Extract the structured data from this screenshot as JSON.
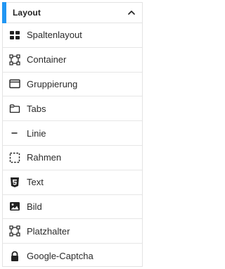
{
  "colors": {
    "accent": "#2196f3",
    "icon": "#222222",
    "text": "#2b2b2b",
    "divider": "#e6e6e6"
  },
  "panel": {
    "title": "Layout",
    "collapse_icon": "chevron-up-icon",
    "items": [
      {
        "label": "Spaltenlayout",
        "icon": "columns-grid-icon"
      },
      {
        "label": "Container",
        "icon": "container-frame-icon"
      },
      {
        "label": "Gruppierung",
        "icon": "window-group-icon"
      },
      {
        "label": "Tabs",
        "icon": "folder-tab-icon"
      },
      {
        "label": "Linie",
        "icon": "horizontal-line-icon"
      },
      {
        "label": "Rahmen",
        "icon": "dashed-border-icon"
      },
      {
        "label": "Text",
        "icon": "html5-text-icon"
      },
      {
        "label": "Bild",
        "icon": "image-icon"
      },
      {
        "label": "Platzhalter",
        "icon": "placeholder-frame-icon"
      },
      {
        "label": "Google-Captcha",
        "icon": "lock-icon"
      }
    ]
  }
}
